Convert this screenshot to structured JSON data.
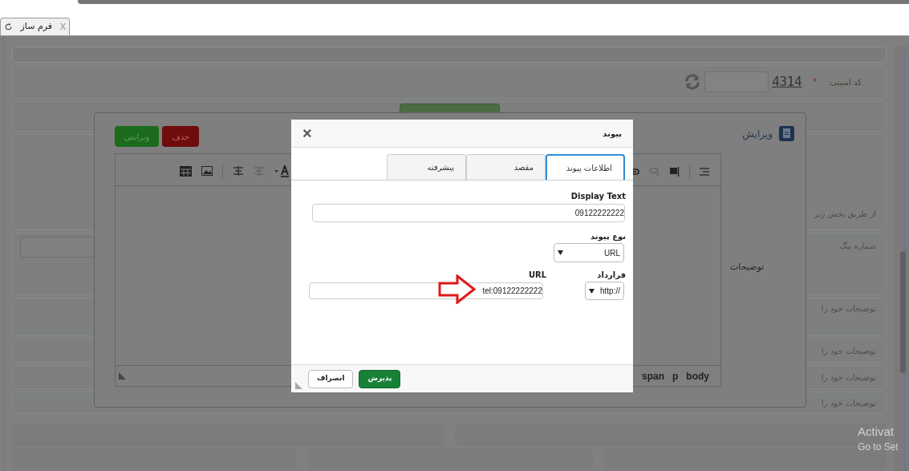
{
  "browser_tab": {
    "label": "فرم ساز",
    "close": "X"
  },
  "form": {
    "captcha": {
      "label": "کد امنیتی:",
      "required": "*",
      "code": "4314"
    },
    "rows": [
      {
        "text": "از طریق بخش زیر"
      },
      {
        "text": "شماره پیگ"
      },
      {
        "text": "توضیحات خود را"
      },
      {
        "text": "توضیحات خود را"
      },
      {
        "text": "توضیحات خود را"
      },
      {
        "text": "توضیحات خود را"
      }
    ]
  },
  "edit_dialog": {
    "title": "ویرایش",
    "buttons": [
      {
        "label": "حذف",
        "kind": "danger"
      },
      {
        "label": "ویرایش",
        "kind": "primary"
      }
    ],
    "field_label": "توضیحات",
    "breadcrumb": [
      "body",
      "p",
      "span"
    ]
  },
  "link_dialog": {
    "title": "پیوند",
    "close": "×",
    "tabs": [
      {
        "label": "اطلاعات پیوند",
        "selected": true
      },
      {
        "label": "مقصد",
        "selected": false
      },
      {
        "label": "پیشرفته",
        "selected": false
      }
    ],
    "display_text": {
      "label": "Display Text",
      "value": "09122222222"
    },
    "link_type": {
      "label": "نوع پیوند",
      "value": "URL"
    },
    "protocol": {
      "label": "قرارداد",
      "value": "http://"
    },
    "url": {
      "label": "URL",
      "value": "tel:09122222222"
    },
    "buttons": [
      {
        "label": "پذیرش",
        "kind": "primary"
      },
      {
        "label": "انصراف",
        "kind": "secondary"
      }
    ]
  },
  "os_notice": [
    "Activat",
    "Go to Set"
  ]
}
